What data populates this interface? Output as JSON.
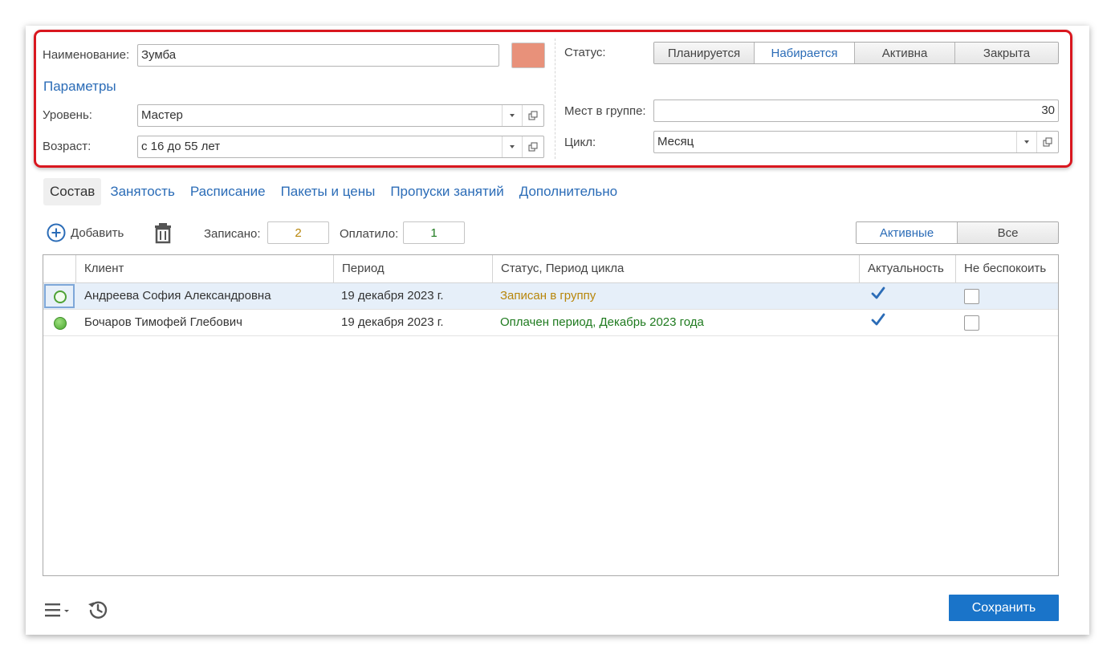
{
  "form": {
    "name_label": "Наименование:",
    "name_value": "Зумба",
    "color": "#e8917a",
    "params_title": "Параметры",
    "level_label": "Уровень:",
    "level_value": "Мастер",
    "age_label": "Возраст:",
    "age_value": "с 16 до 55 лет",
    "status_label": "Статус:",
    "status_options": [
      "Планируется",
      "Набирается",
      "Активна",
      "Закрыта"
    ],
    "status_selected": "Набирается",
    "seats_label": "Мест в группе:",
    "seats_value": "30",
    "cycle_label": "Цикл:",
    "cycle_value": "Месяц"
  },
  "tabs": [
    {
      "label": "Состав",
      "active": true
    },
    {
      "label": "Занятость"
    },
    {
      "label": "Расписание"
    },
    {
      "label": "Пакеты и цены"
    },
    {
      "label": "Пропуски занятий"
    },
    {
      "label": "Дополнительно"
    }
  ],
  "toolbar": {
    "add_label": "Добавить",
    "enrolled_label": "Записано:",
    "enrolled_value": "2",
    "paid_label": "Оплатило:",
    "paid_value": "1",
    "filter_options": [
      "Активные",
      "Все"
    ],
    "filter_selected": "Активные"
  },
  "table": {
    "columns": [
      "Клиент",
      "Период",
      "Статус, Период цикла",
      "Актуальность",
      "Не беспокоить"
    ],
    "rows": [
      {
        "client": "Андреева София Александровна",
        "period": "19 декабря 2023 г.",
        "status": "Записан в группу",
        "status_color": "#b8860b",
        "actual": true,
        "do_not_disturb": false,
        "indicator": "hollow"
      },
      {
        "client": "Бочаров Тимофей Глебович",
        "period": "19 декабря 2023 г.",
        "status": "Оплачен период, Декабрь 2023 года",
        "status_color": "#1e7a1e",
        "actual": true,
        "do_not_disturb": false,
        "indicator": "full"
      }
    ]
  },
  "footer": {
    "save_label": "Сохранить"
  },
  "colors": {
    "accent": "#2b6cb7",
    "save_button": "#1a74c9",
    "highlight_border": "#d9171f",
    "enrolled_text": "#b8860b",
    "paid_text": "#1e7a1e"
  },
  "icons": {
    "add": "plus-circle-icon",
    "delete": "trash-icon",
    "menu": "hamburger-menu-icon",
    "history": "history-icon",
    "check": "checkmark-icon",
    "open": "open-window-icon"
  }
}
